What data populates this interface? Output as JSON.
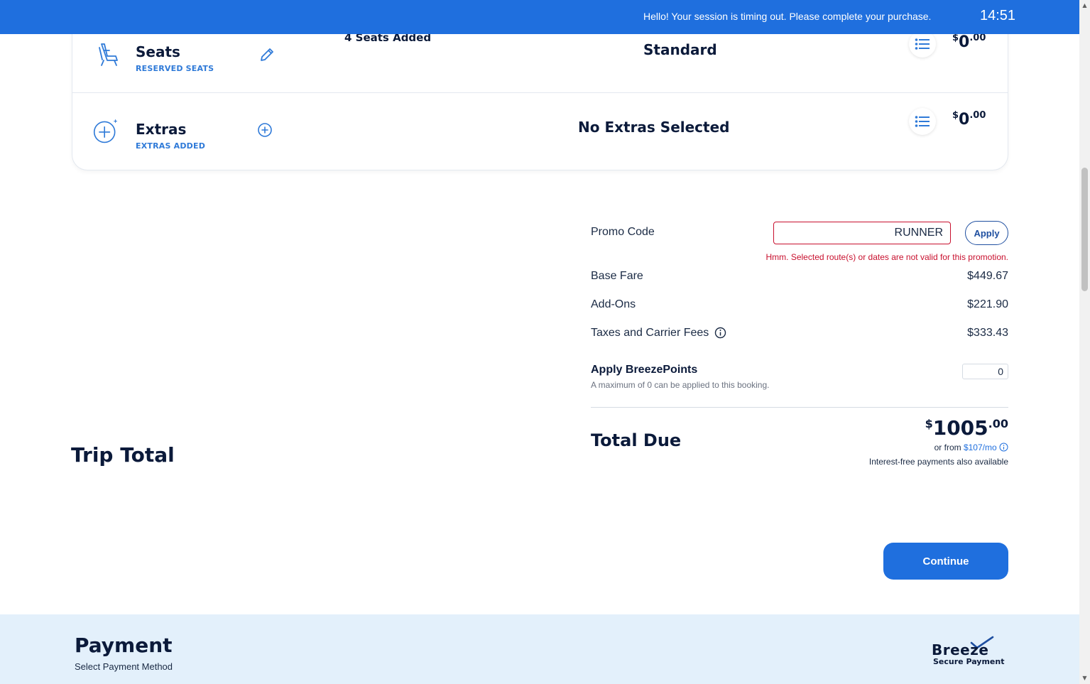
{
  "session": {
    "message": "Hello! Your session is timing out. Please complete your purchase.",
    "timer": "14:51"
  },
  "summary": {
    "seats": {
      "title": "Seats",
      "subtitle": "RESERVED SEATS",
      "detail": "4 Seats Added",
      "center": "Standard",
      "price_currency": "$",
      "price_whole": "0",
      "price_cents": ".00"
    },
    "extras": {
      "title": "Extras",
      "subtitle": "EXTRAS ADDED",
      "center": "No Extras Selected",
      "price_currency": "$",
      "price_whole": "0",
      "price_cents": ".00"
    }
  },
  "totals": {
    "promo_label": "Promo Code",
    "promo_value": "RUNNER",
    "apply_label": "Apply",
    "promo_error": "Hmm. Selected route(s) or dates are not valid for this promotion.",
    "base_fare_label": "Base Fare",
    "base_fare_value": "$449.67",
    "addons_label": "Add-Ons",
    "addons_value": "$221.90",
    "taxes_label": "Taxes and Carrier Fees",
    "taxes_value": "$333.43",
    "points_label": "Apply BreezePoints",
    "points_note": "A maximum of 0 can be applied to this booking.",
    "points_value": "0",
    "total_due_label": "Total Due",
    "total_currency": "$",
    "total_whole": "1005",
    "total_cents": ".00",
    "finance_prefix": "or from ",
    "finance_link": "$107/mo",
    "finance_note": "Interest-free payments also available"
  },
  "trip_total_label": "Trip Total",
  "continue_label": "Continue",
  "payment": {
    "title": "Payment",
    "subtitle": "Select Payment Method",
    "logo_word": "Breeze",
    "logo_sub": "Secure Payment"
  },
  "colors": {
    "brand_blue": "#1f6fde",
    "error_red": "#c8102e",
    "navy": "#0b1a3a",
    "payment_bg": "#e3f0fb"
  },
  "icons": {
    "seats": "seat-icon",
    "extras": "plus-circle-icon",
    "edit": "pencil-icon",
    "add": "add-circle-icon",
    "list": "list-icon",
    "info": "info-icon",
    "logo_check": "checkmark-icon"
  }
}
